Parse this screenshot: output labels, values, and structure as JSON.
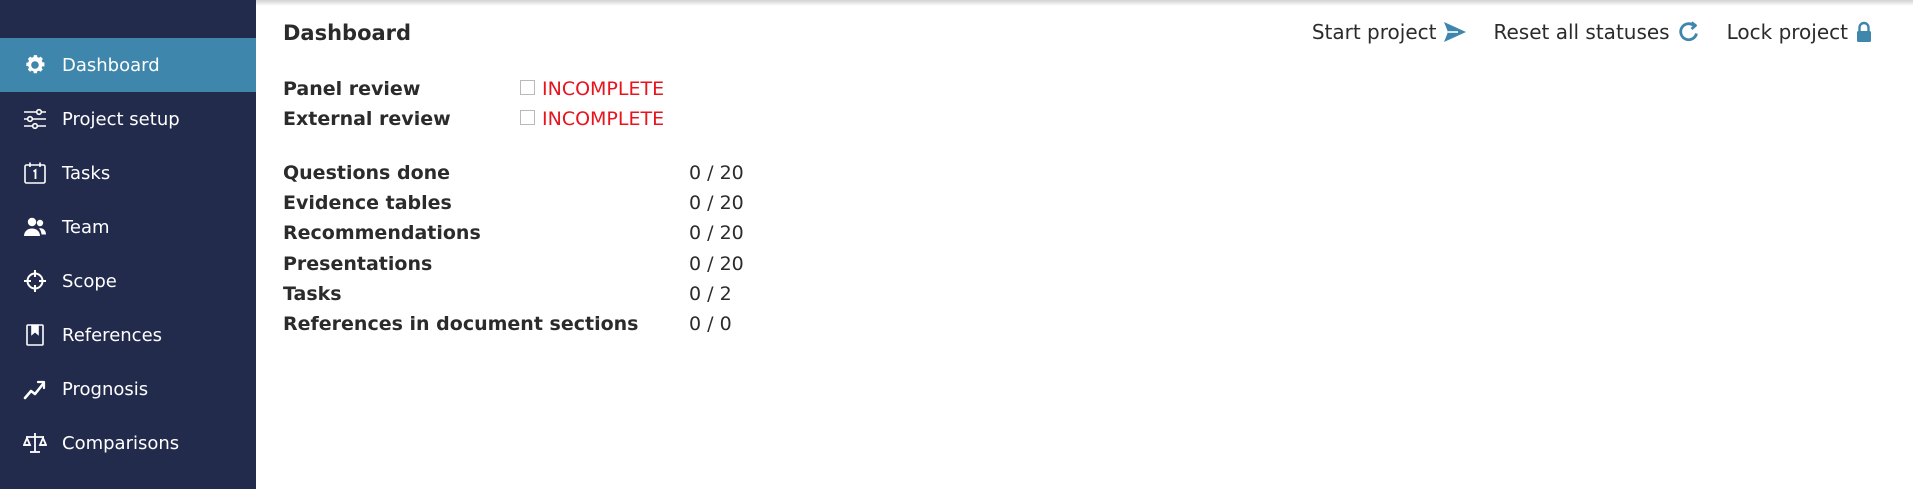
{
  "sidebar": {
    "items": [
      {
        "label": "Dashboard",
        "icon": "gear-icon",
        "active": true
      },
      {
        "label": "Project setup",
        "icon": "sliders-icon"
      },
      {
        "label": "Tasks",
        "icon": "calendar-icon"
      },
      {
        "label": "Team",
        "icon": "team-icon"
      },
      {
        "label": "Scope",
        "icon": "crosshair-icon"
      },
      {
        "label": "References",
        "icon": "bookmark-icon"
      },
      {
        "label": "Prognosis",
        "icon": "trend-up-icon"
      },
      {
        "label": "Comparisons",
        "icon": "scales-icon"
      }
    ],
    "background": "#232b4d",
    "active_color": "#3e86ab"
  },
  "header": {
    "title": "Dashboard",
    "actions": [
      {
        "label": "Start project",
        "icon": "send-icon"
      },
      {
        "label": "Reset all statuses",
        "icon": "refresh-icon"
      },
      {
        "label": "Lock project",
        "icon": "lock-icon"
      }
    ],
    "accent": "#3e86ab"
  },
  "statuses": [
    {
      "label": "Panel review",
      "value": "INCOMPLETE"
    },
    {
      "label": "External review",
      "value": "INCOMPLETE"
    }
  ],
  "status_color": "#e8131c",
  "stats": [
    {
      "label": "Questions done",
      "value": "0 / 20"
    },
    {
      "label": "Evidence tables",
      "value": "0 / 20"
    },
    {
      "label": "Recommendations",
      "value": "0 / 20"
    },
    {
      "label": "Presentations",
      "value": "0 / 20"
    },
    {
      "label": "Tasks",
      "value": "0 / 2"
    },
    {
      "label": "References in document sections",
      "value": "0 / 0"
    }
  ]
}
